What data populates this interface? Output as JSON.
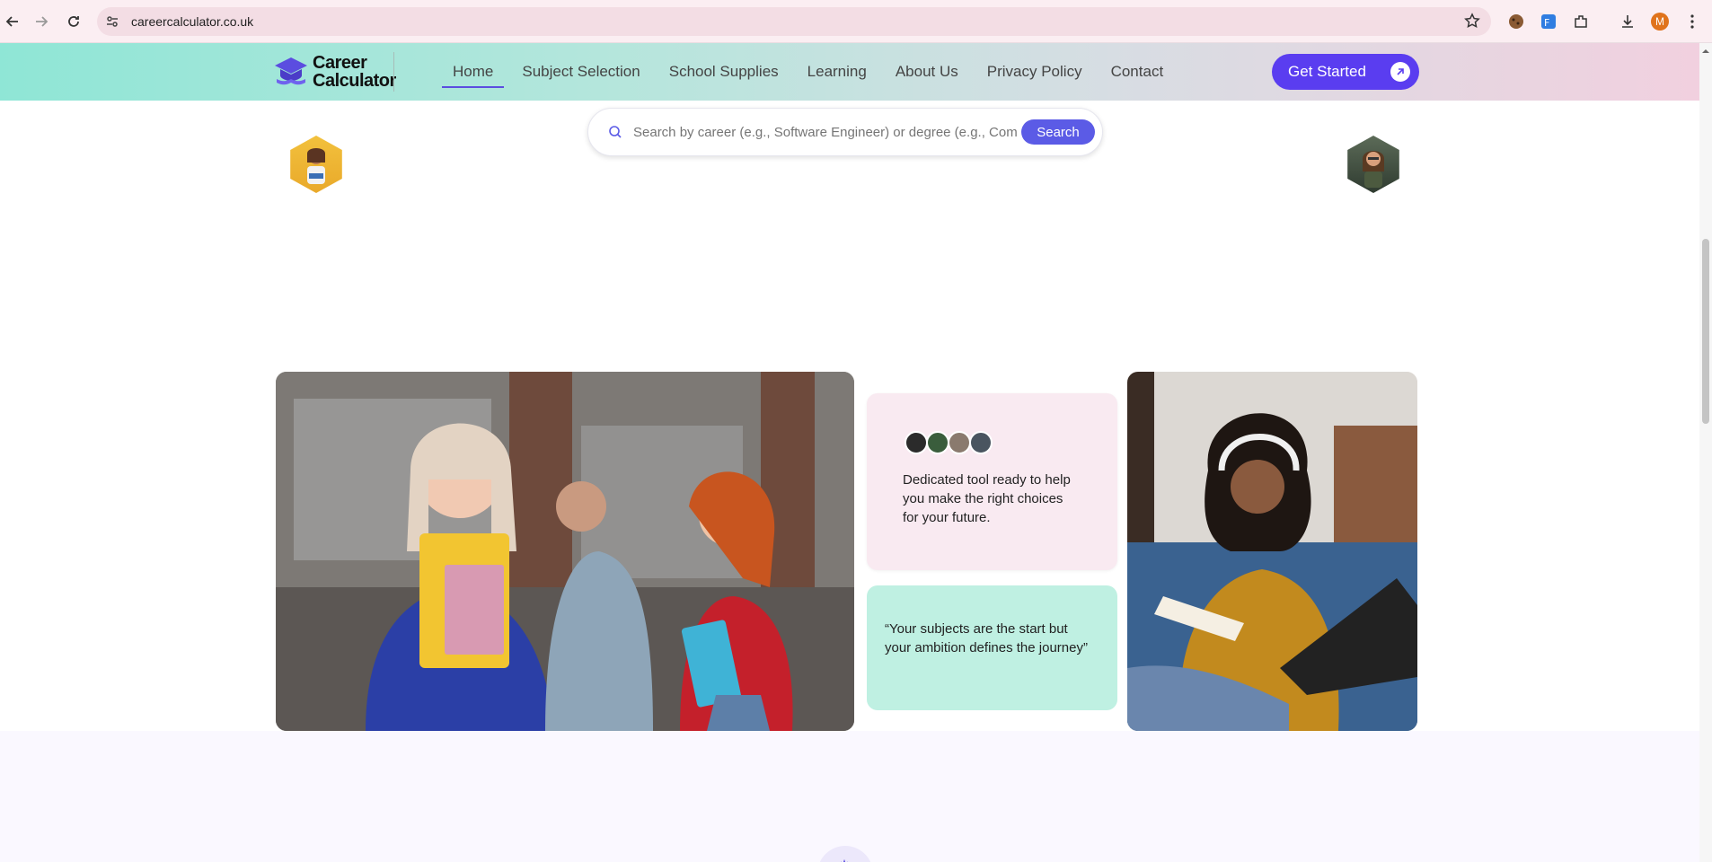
{
  "browser": {
    "url": "careercalculator.co.uk",
    "profile_initial": "M"
  },
  "site": {
    "logo_line1": "Career",
    "logo_line2": "Calculator",
    "nav": [
      {
        "label": "Home"
      },
      {
        "label": "Subject Selection"
      },
      {
        "label": "School Supplies"
      },
      {
        "label": "Learning"
      },
      {
        "label": "About Us"
      },
      {
        "label": "Privacy Policy"
      },
      {
        "label": "Contact"
      }
    ],
    "cta_label": "Get Started",
    "accent": "#5a3df0"
  },
  "search": {
    "placeholder": "Search by career (e.g., Software Engineer) or degree (e.g., Com",
    "button_label": "Search"
  },
  "cards": {
    "tool_text": "Dedicated tool ready to help you make the right choices for your future.",
    "quote_text": "“Your subjects are the start but your ambition defines the journey”"
  },
  "colors": {
    "pink_card": "#f9eaf1",
    "mint_card": "#bff0e2",
    "header_gradient_start": "#8fe6d6",
    "header_gradient_end": "#f2d0df"
  }
}
